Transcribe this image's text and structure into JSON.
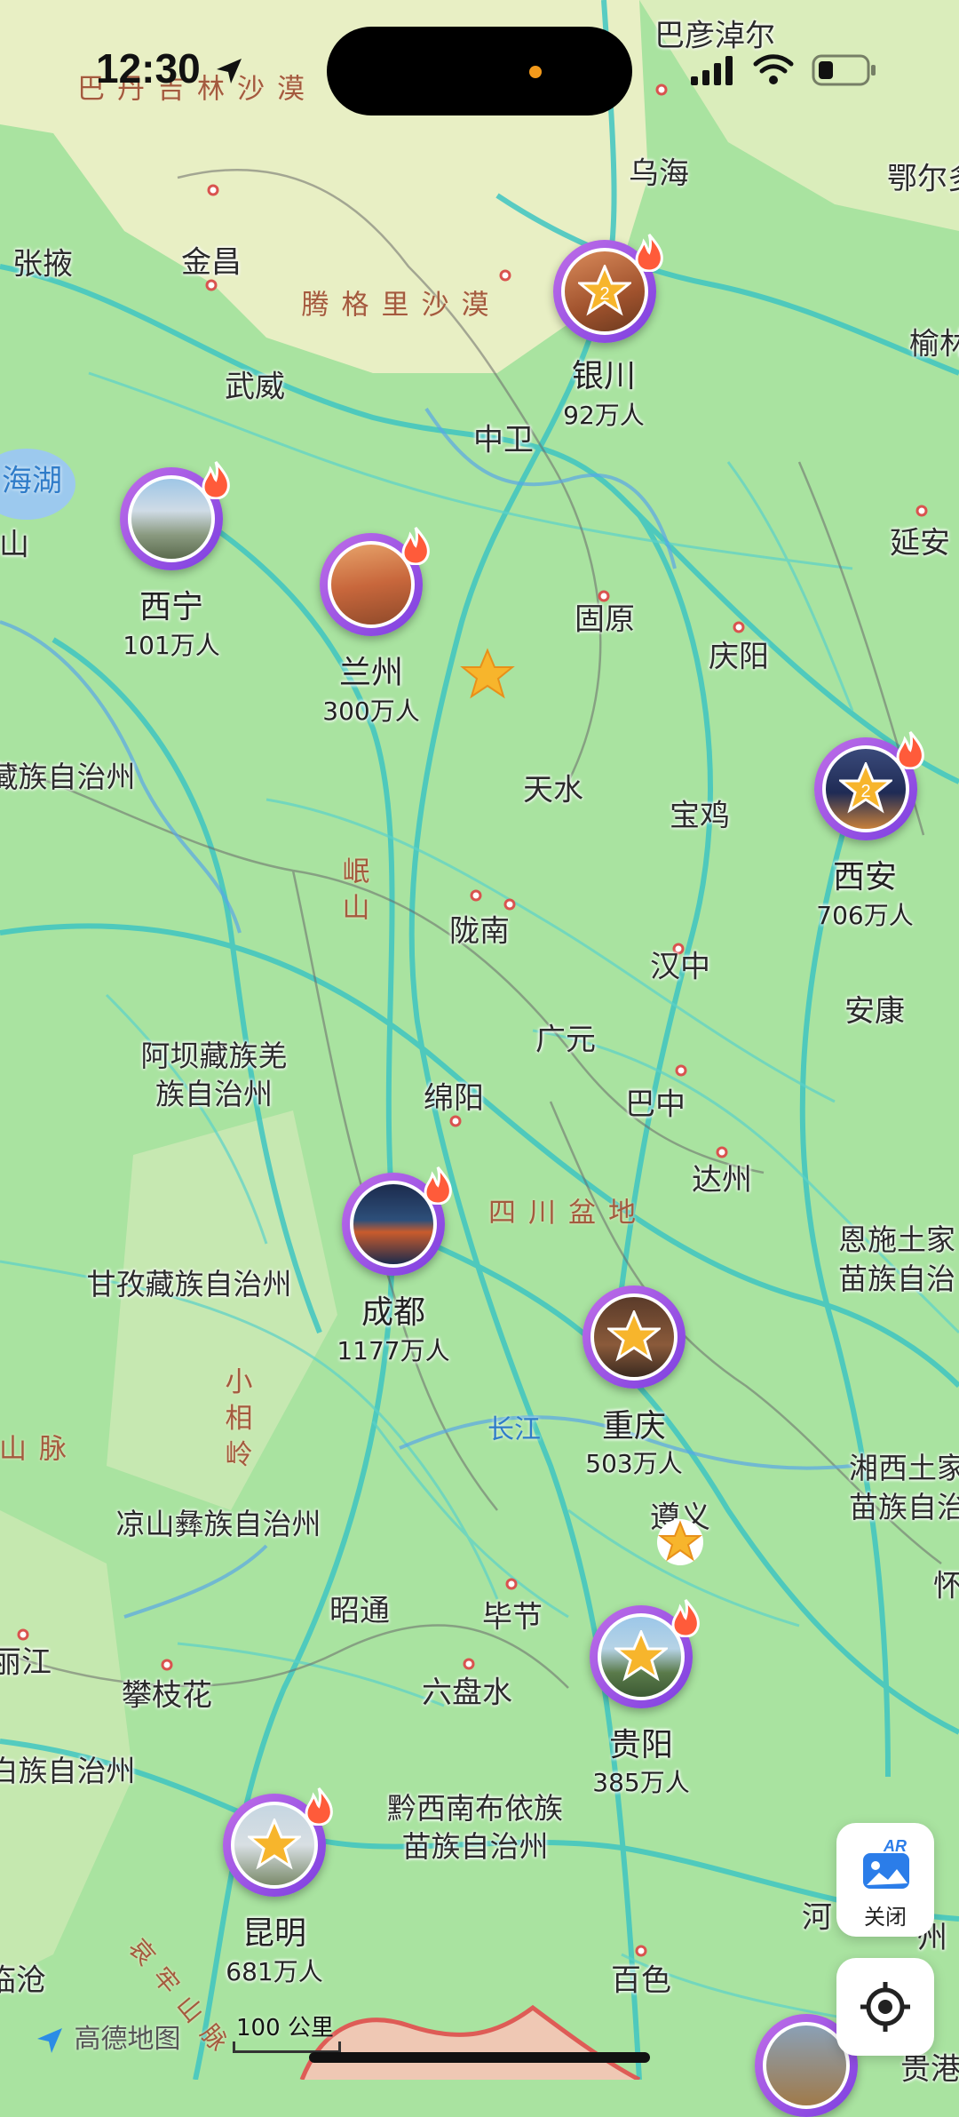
{
  "status": {
    "time": "12:30"
  },
  "regions": {
    "badain": "巴丹吉林沙漠",
    "tengger": "腾格里沙漠",
    "sichuan_basin": "四川盆地",
    "minshan": "岷山",
    "xiaoxiangling": "小相岭",
    "shanmai": "山脉",
    "changjiang": "长江",
    "qinghai_lake": "海湖",
    "bottom_range": "哀牢山脉"
  },
  "cities": {
    "bayannur": "巴彦淖尔",
    "wuhai": "乌海",
    "ordos": "鄂尔多",
    "zhangye": "张掖",
    "jinchang": "金昌",
    "yulin": "榆林",
    "wuwei": "武威",
    "zhongwei": "中卫",
    "yanan": "延安",
    "guyuan": "固原",
    "qingyang": "庆阳",
    "tianshui": "天水",
    "baoji": "宝鸡",
    "longnan": "陇南",
    "hanzhong": "汉中",
    "ankang": "安康",
    "guangyuan": "广元",
    "mianyang": "绵阳",
    "bazhong": "巴中",
    "dazhou": "达州",
    "zunyi": "遵义",
    "zhaotong": "昭通",
    "bijie": "毕节",
    "lijiang": "丽江",
    "panzhihua": "攀枝花",
    "liupanshui": "六盘水",
    "baise": "百色",
    "he": "河",
    "huai": "怀",
    "gui": "贵港",
    "lincang": "临沧",
    "shan": "山",
    "zhou": "州"
  },
  "prefectures": {
    "haibei": "藏族自治州",
    "aba_1": "阿坝藏族羌",
    "aba_2": "族自治州",
    "ganzi": "甘孜藏族自治州",
    "enshi_1": "恩施土家",
    "enshi_2": "苗族自治",
    "liangshan": "凉山彝族自治州",
    "xiangxi_1": "湘西土家",
    "xiangxi_2": "苗族自治",
    "qianxinan_1": "黔西南布依族",
    "qianxinan_2": "苗族自治州",
    "dali": "白族自治州"
  },
  "markers": [
    {
      "name": "银川",
      "population": "92万人",
      "badge": "2"
    },
    {
      "name": "西宁",
      "population": "101万人",
      "badge": ""
    },
    {
      "name": "兰州",
      "population": "300万人",
      "badge": ""
    },
    {
      "name": "西安",
      "population": "706万人",
      "badge": "2"
    },
    {
      "name": "成都",
      "population": "1177万人",
      "badge": ""
    },
    {
      "name": "重庆",
      "population": "503万人",
      "badge": ""
    },
    {
      "name": "贵阳",
      "population": "385万人",
      "badge": ""
    },
    {
      "name": "昆明",
      "population": "681万人",
      "badge": ""
    }
  ],
  "controls": {
    "ar_label": "关闭",
    "ar_badge": "AR"
  },
  "footer": {
    "logo": "高德地图",
    "scale": "100 公里"
  },
  "colors": {
    "land": "#a9e3a0",
    "desert": "#f4e8c9",
    "road": "#3fc0c0",
    "marker_ring": "#9b52e6",
    "star": "#f7b52c"
  }
}
